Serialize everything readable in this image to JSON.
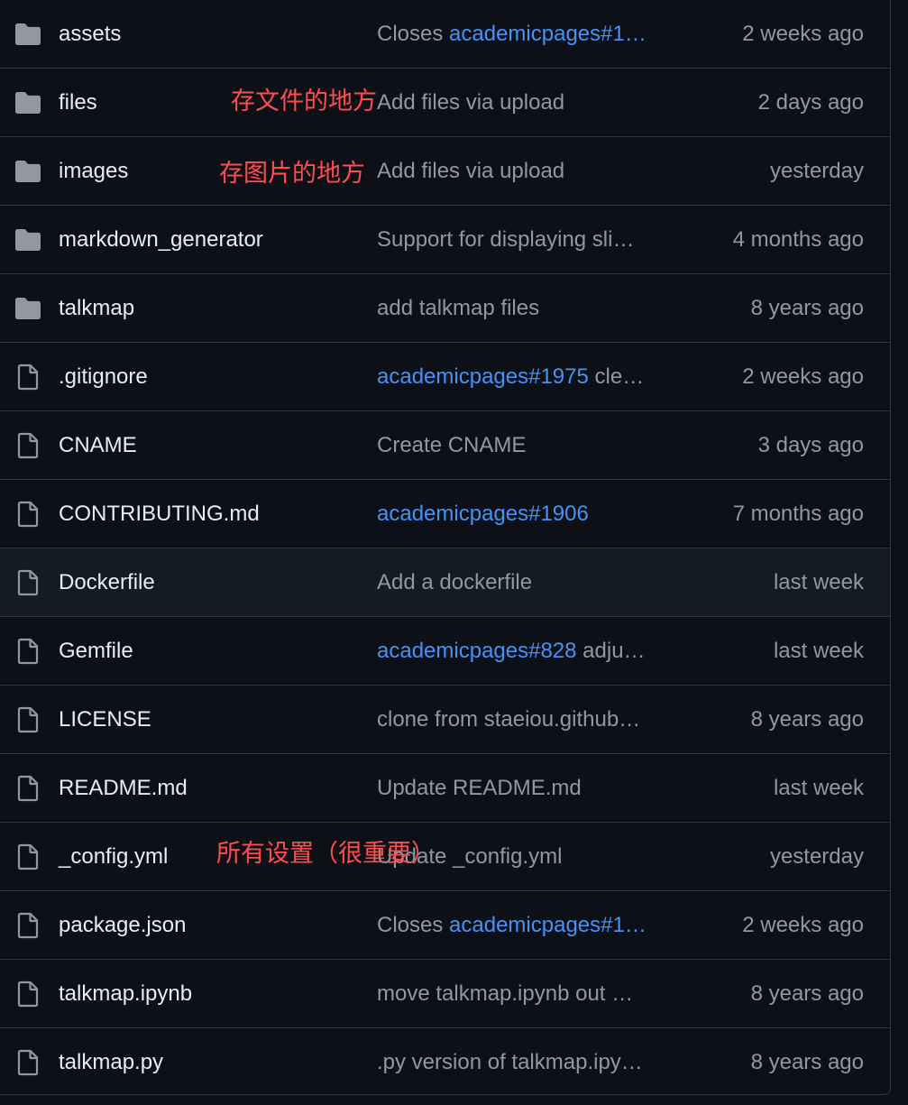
{
  "rows": [
    {
      "name": "assets",
      "type": "folder",
      "commit_prefix": "Closes ",
      "commit_link": "academicpages#1…",
      "commit_suffix": "",
      "when": "2 weeks ago"
    },
    {
      "name": "files",
      "type": "folder",
      "commit_prefix": "Add files via upload",
      "commit_link": "",
      "commit_suffix": "",
      "when": "2 days ago"
    },
    {
      "name": "images",
      "type": "folder",
      "commit_prefix": "Add files via upload",
      "commit_link": "",
      "commit_suffix": "",
      "when": "yesterday"
    },
    {
      "name": "markdown_generator",
      "type": "folder",
      "commit_prefix": "Support for displaying sli…",
      "commit_link": "",
      "commit_suffix": "",
      "when": "4 months ago"
    },
    {
      "name": "talkmap",
      "type": "folder",
      "commit_prefix": "add talkmap files",
      "commit_link": "",
      "commit_suffix": "",
      "when": "8 years ago"
    },
    {
      "name": ".gitignore",
      "type": "file",
      "commit_prefix": "",
      "commit_link": "academicpages#1975",
      "commit_suffix": " cle…",
      "when": "2 weeks ago"
    },
    {
      "name": "CNAME",
      "type": "file",
      "commit_prefix": "Create CNAME",
      "commit_link": "",
      "commit_suffix": "",
      "when": "3 days ago"
    },
    {
      "name": "CONTRIBUTING.md",
      "type": "file",
      "commit_prefix": "",
      "commit_link": "academicpages#1906",
      "commit_suffix": "",
      "when": "7 months ago"
    },
    {
      "name": "Dockerfile",
      "type": "file",
      "commit_prefix": "Add a dockerfile",
      "commit_link": "",
      "commit_suffix": "",
      "when": "last week"
    },
    {
      "name": "Gemfile",
      "type": "file",
      "commit_prefix": "",
      "commit_link": "academicpages#828",
      "commit_suffix": " adju…",
      "when": "last week"
    },
    {
      "name": "LICENSE",
      "type": "file",
      "commit_prefix": "clone from staeiou.github…",
      "commit_link": "",
      "commit_suffix": "",
      "when": "8 years ago"
    },
    {
      "name": "README.md",
      "type": "file",
      "commit_prefix": "Update README.md",
      "commit_link": "",
      "commit_suffix": "",
      "when": "last week"
    },
    {
      "name": "_config.yml",
      "type": "file",
      "commit_prefix": "Update _config.yml",
      "commit_link": "",
      "commit_suffix": "",
      "when": "yesterday"
    },
    {
      "name": "package.json",
      "type": "file",
      "commit_prefix": "Closes ",
      "commit_link": "academicpages#1…",
      "commit_suffix": "",
      "when": "2 weeks ago"
    },
    {
      "name": "talkmap.ipynb",
      "type": "file",
      "commit_prefix": "move talkmap.ipynb out …",
      "commit_link": "",
      "commit_suffix": "",
      "when": "8 years ago"
    },
    {
      "name": "talkmap.py",
      "type": "file",
      "commit_prefix": ".py version of talkmap.ipy…",
      "commit_link": "",
      "commit_suffix": "",
      "when": "8 years ago"
    }
  ],
  "annotations": {
    "files_note": "存文件的地方",
    "images_note": "存图片的地方",
    "config_note": "所有设置（很重要）"
  },
  "colors": {
    "background": "#0d1117",
    "text": "#e6edf3",
    "muted": "#9198a1",
    "link": "#4493f8",
    "border": "#30363d",
    "annotation": "#ff4d4f"
  }
}
